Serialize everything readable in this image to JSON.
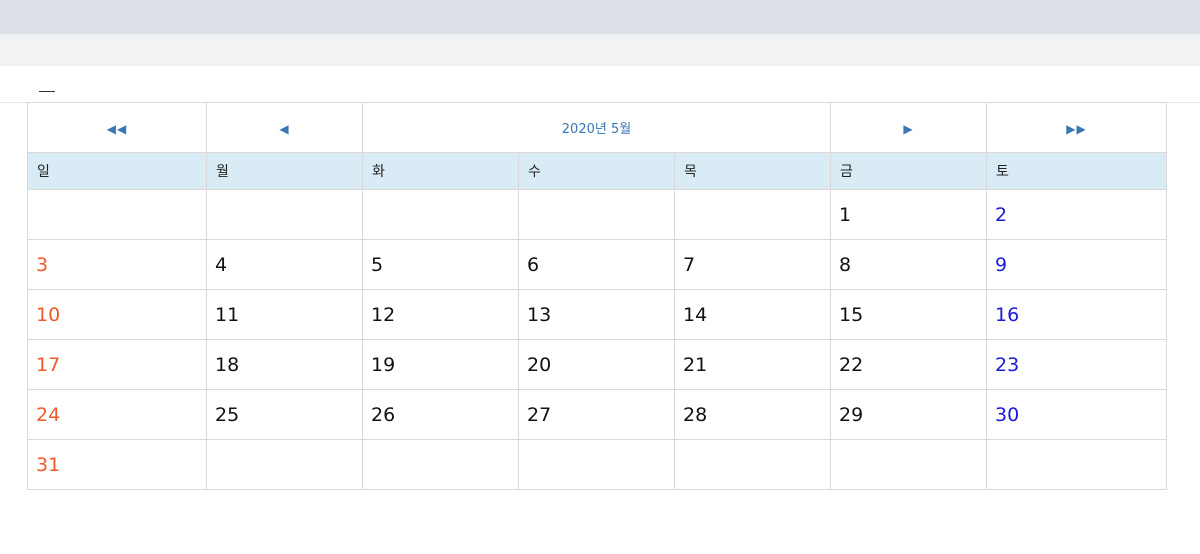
{
  "calendar": {
    "title": "2020년 5월",
    "nav": {
      "prev_year": "◀◀",
      "prev_month": "◀",
      "next_month": "▶",
      "next_year": "▶▶"
    },
    "weekdays": [
      "일",
      "월",
      "화",
      "수",
      "목",
      "금",
      "토"
    ],
    "weeks": [
      [
        "",
        "",
        "",
        "",
        "",
        "1",
        "2"
      ],
      [
        "3",
        "4",
        "5",
        "6",
        "7",
        "8",
        "9"
      ],
      [
        "10",
        "11",
        "12",
        "13",
        "14",
        "15",
        "16"
      ],
      [
        "17",
        "18",
        "19",
        "20",
        "21",
        "22",
        "23"
      ],
      [
        "24",
        "25",
        "26",
        "27",
        "28",
        "29",
        "30"
      ],
      [
        "31",
        "",
        "",
        "",
        "",
        "",
        ""
      ]
    ],
    "colors": {
      "nav_text": "#3a76b5",
      "header_bg": "#d9ecf6",
      "sunday": "#f05a28",
      "saturday": "#1a1ad8"
    }
  }
}
